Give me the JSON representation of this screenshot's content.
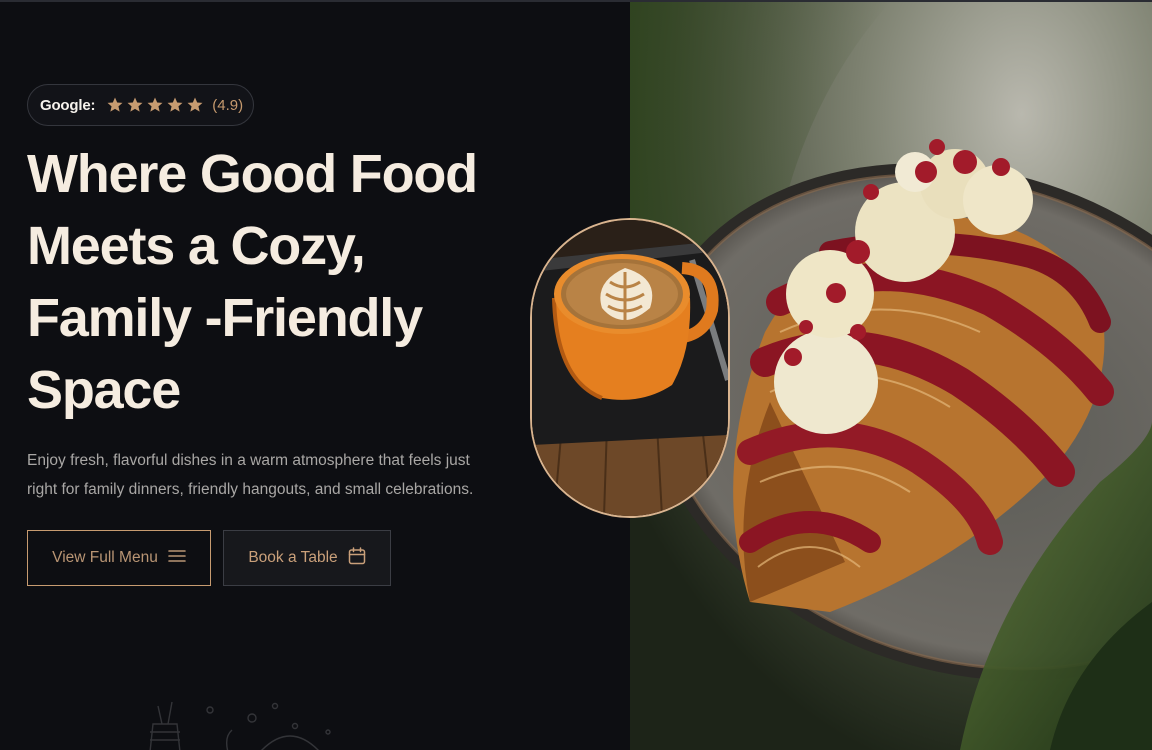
{
  "rating": {
    "source_label": "Google:",
    "score_text": "(4.9)",
    "stars": 5,
    "star_color": "#c79b70"
  },
  "hero": {
    "title_lines": [
      "Where Good Food",
      "Meets a Cozy,",
      "Family -Friendly",
      "Space"
    ],
    "description_lines": [
      "Enjoy fresh, flavorful dishes in a warm atmosphere that feels just",
      "right for family dinners, friendly hangouts, and small celebrations."
    ]
  },
  "buttons": {
    "menu_label": "View Full Menu",
    "menu_icon": "menu-lines-icon",
    "book_label": "Book a Table",
    "book_icon": "calendar-icon"
  },
  "images": {
    "main_photo": "croissant-with-cream-and-berry-glaze",
    "inset_photo": "latte-art-coffee-cup"
  },
  "colors": {
    "background": "#0d0e12",
    "accent": "#c79b70",
    "heading": "#f5ece0",
    "body_text": "#a9a7a5"
  }
}
